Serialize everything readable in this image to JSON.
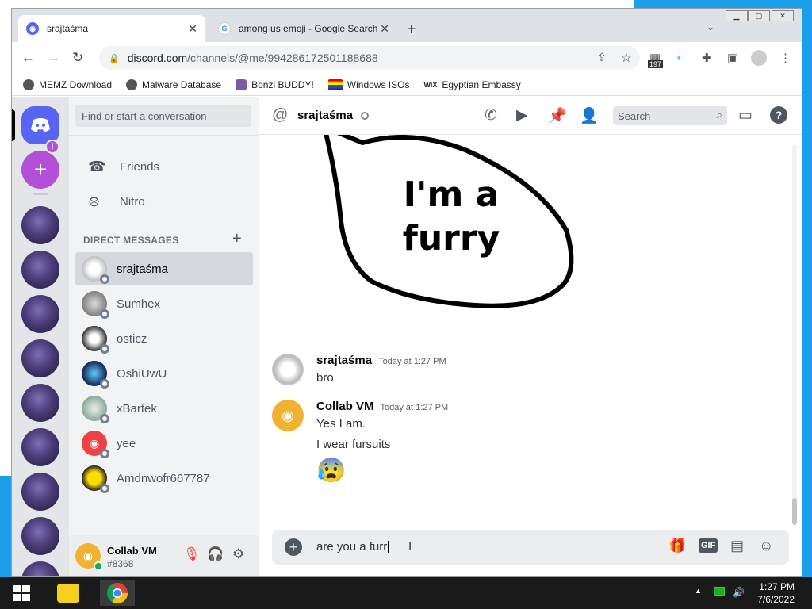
{
  "browser": {
    "tabs": [
      {
        "title": "srajtaśma",
        "active": true
      },
      {
        "title": "among us emoji - Google Search",
        "active": false
      }
    ],
    "url_host": "discord.com",
    "url_path": "/channels/@me/994286172501188688",
    "extension_badge": "197",
    "bookmarks": [
      "MEMZ Download",
      "Malware Database",
      "Bonzi BUDDY!",
      "Windows ISOs",
      "Egyptian Embassy"
    ]
  },
  "discord": {
    "search_placeholder": "Find or start a conversation",
    "nav": {
      "friends": "Friends",
      "nitro": "Nitro"
    },
    "dm_header": "DIRECT MESSAGES",
    "dms": [
      {
        "name": "srajtaśma",
        "active": true
      },
      {
        "name": "Sumhex",
        "active": false
      },
      {
        "name": "osticz",
        "active": false
      },
      {
        "name": "OshiUwU",
        "active": false
      },
      {
        "name": "xBartek",
        "active": false
      },
      {
        "name": "yee",
        "active": false
      },
      {
        "name": "Amdnwofr667787",
        "active": false
      }
    ],
    "server_badge": "!",
    "user": {
      "name": "Collab VM",
      "tag": "#8368"
    },
    "channel": {
      "name": "srajtaśma",
      "search_placeholder": "Search"
    },
    "image_caption": "I'm a furry",
    "messages": [
      {
        "author": "srajtaśma",
        "time": "Today at 1:27 PM",
        "lines": [
          "bro"
        ]
      },
      {
        "author": "Collab VM",
        "time": "Today at 1:27 PM",
        "lines": [
          "Yes I am.",
          "I wear fursuits"
        ],
        "emoji": "😰"
      }
    ],
    "composer_text": "are you a furr",
    "composer_gif": "GIF"
  },
  "taskbar": {
    "time": "1:27 PM",
    "date": "7/6/2022"
  },
  "colors": {
    "blurple": "#5865f2",
    "sidebar": "#f2f3f5",
    "server_rail": "#e3e5e8",
    "desktop": "#1a9fe8"
  }
}
